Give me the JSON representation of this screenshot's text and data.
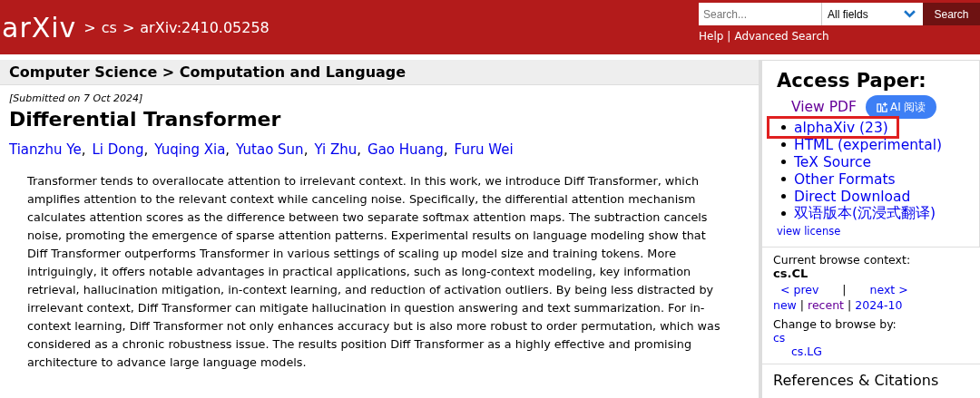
{
  "header": {
    "logo": "arXiv",
    "breadcrumb": {
      "separator": ">",
      "items": [
        "cs",
        "arXiv:2410.05258"
      ]
    },
    "search": {
      "placeholder": "Search...",
      "field": "All fields",
      "button": "Search"
    },
    "links": {
      "separator": "|",
      "items": [
        "Help",
        "Advanced Search"
      ]
    }
  },
  "subheader": "Computer Science > Computation and Language",
  "paper": {
    "submitted": "[Submitted on 7 Oct 2024]",
    "title": "Differential Transformer",
    "authors": [
      {
        "name": "Tianzhu Ye",
        "sep": ","
      },
      {
        "name": "Li Dong",
        "sep": ","
      },
      {
        "name": "Yuqing Xia",
        "sep": ","
      },
      {
        "name": "Yutao Sun",
        "sep": ","
      },
      {
        "name": "Yi Zhu",
        "sep": ","
      },
      {
        "name": "Gao Huang",
        "sep": ","
      },
      {
        "name": "Furu Wei"
      }
    ],
    "abstract": "Transformer tends to overallocate attention to irrelevant context. In this work, we introduce Diff Transformer, which amplifies attention to the relevant context while canceling noise. Specifically, the differential attention mechanism calculates attention scores as the difference between two separate softmax attention maps. The subtraction cancels noise, promoting the emergence of sparse attention patterns. Experimental results on language modeling show that Diff Transformer outperforms Transformer in various settings of scaling up model size and training tokens. More intriguingly, it offers notable advantages in practical applications, such as long-context modeling, key information retrieval, hallucination mitigation, in-context learning, and reduction of activation outliers. By being less distracted by irrelevant context, Diff Transformer can mitigate hallucination in question answering and text summarization. For in-context learning, Diff Transformer not only enhances accuracy but is also more robust to order permutation, which was considered as a chronic robustness issue. The results position Diff Transformer as a highly effective and promising architecture to advance large language models."
  },
  "access": {
    "heading": "Access Paper:",
    "view_pdf": {
      "text": "View PDF",
      "visited": true
    },
    "ai_button": "AI 阅读",
    "items": [
      {
        "text": "alphaXiv (23)",
        "highlighted": true
      },
      {
        "text": "HTML (experimental)",
        "highlighted": false
      },
      {
        "text": "TeX Source",
        "highlighted": false
      },
      {
        "text": "Other Formats",
        "highlighted": false
      },
      {
        "text": "Direct Download",
        "highlighted": false
      },
      {
        "text": "双语版本(沉浸式翻译)",
        "highlighted": false
      }
    ],
    "license": "view license"
  },
  "browse": {
    "context_label": "Current browse context:",
    "context": "cs.CL",
    "nav": [
      {
        "kind": "link",
        "text": "< prev"
      },
      {
        "kind": "sep",
        "text": "|"
      },
      {
        "kind": "link",
        "text": "next >"
      }
    ],
    "dates": [
      {
        "kind": "link",
        "text": "new",
        "visited": false
      },
      {
        "kind": "sep",
        "text": "|"
      },
      {
        "kind": "link",
        "text": "recent",
        "visited": true
      },
      {
        "kind": "sep",
        "text": "|"
      },
      {
        "kind": "link",
        "text": "2024-10",
        "visited": false
      }
    ],
    "change_label": "Change to browse by:",
    "categories": [
      {
        "text": "cs",
        "children": [
          {
            "text": "cs.LG"
          }
        ]
      }
    ]
  },
  "references_heading": "References & Citations"
}
